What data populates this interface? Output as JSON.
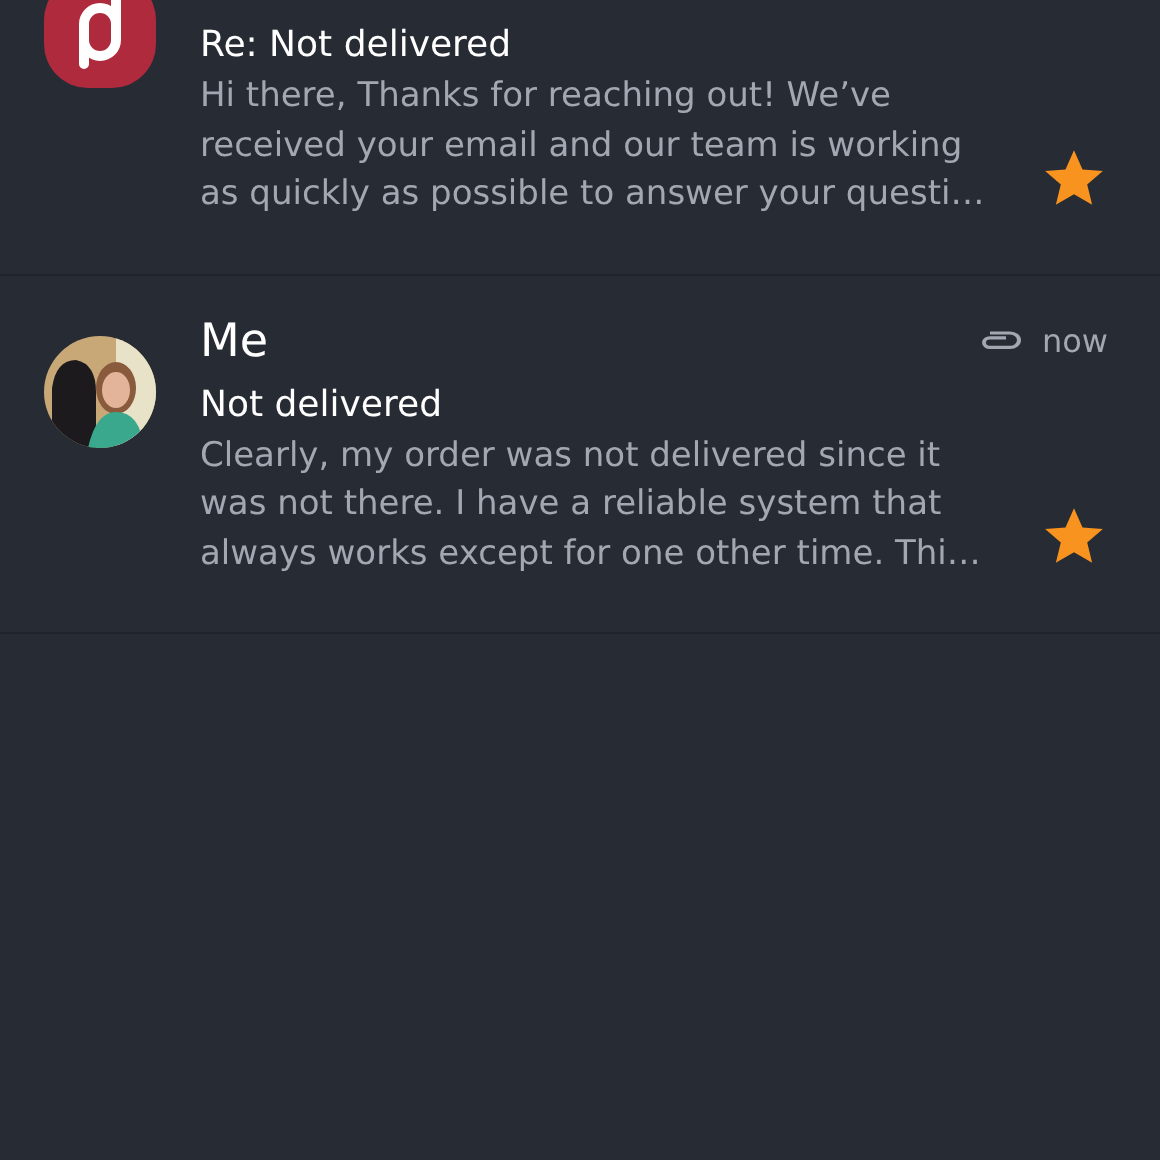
{
  "messages": [
    {
      "avatar": {
        "kind": "logo"
      },
      "subject": "Re: Not delivered",
      "preview_lines": [
        "Hi there, Thanks for reaching out! We’ve",
        "received your email and our team is working",
        "as quickly as possible to answer your questi…"
      ],
      "starred": true
    },
    {
      "sender": "Me",
      "has_attachment": true,
      "time": "now",
      "subject": "Not delivered",
      "preview_lines": [
        "Clearly, my order was not delivered since it",
        "was not there. I have a reliable system that",
        "always works except for one other time. Thi…"
      ],
      "starred": true
    }
  ]
}
